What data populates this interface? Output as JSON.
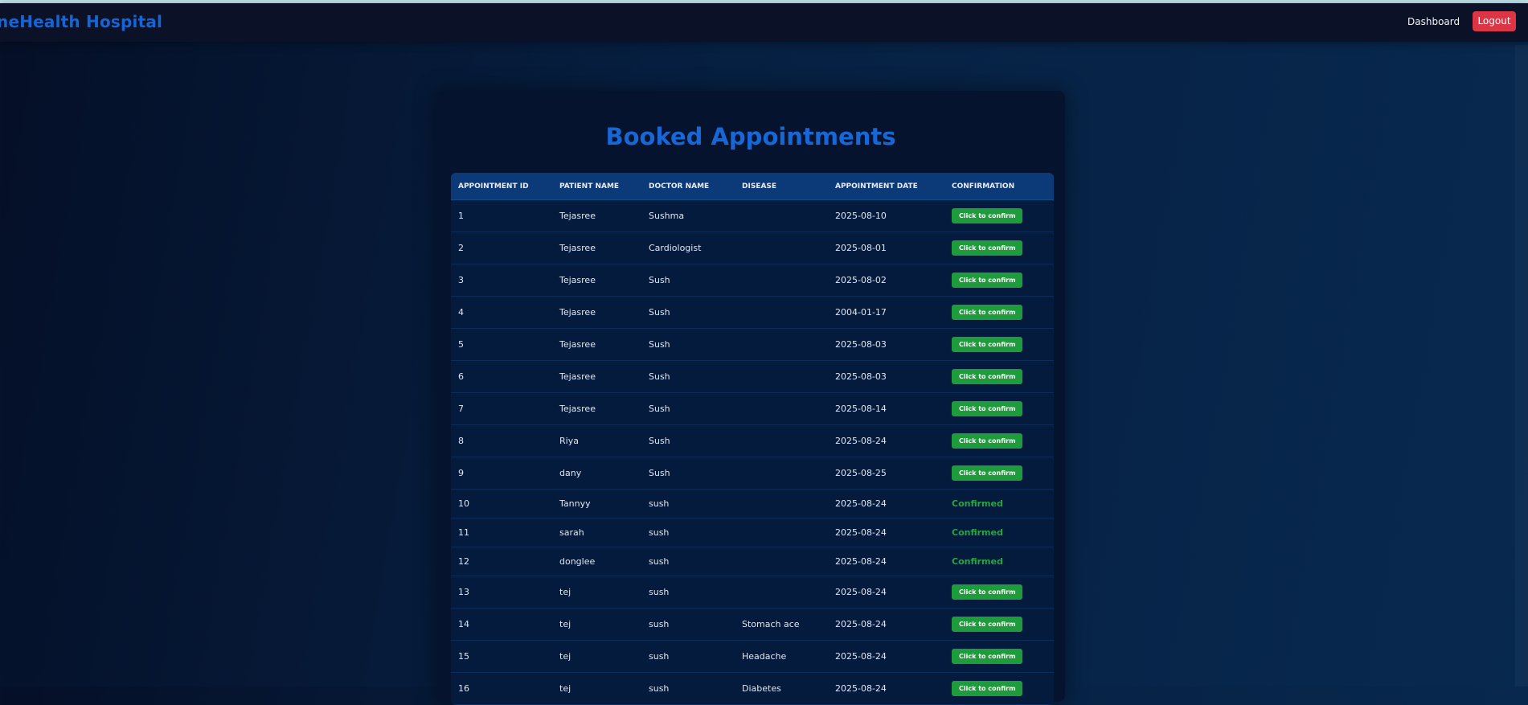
{
  "navbar": {
    "brand": "neHealth Hospital",
    "dashboard_label": "Dashboard",
    "logout_label": "Logout"
  },
  "page": {
    "title": "Booked Appointments"
  },
  "table": {
    "headers": [
      "APPOINTMENT ID",
      "PATIENT NAME",
      "DOCTOR NAME",
      "DISEASE",
      "APPOINTMENT DATE",
      "CONFIRMATION"
    ],
    "rows": [
      {
        "id": "1",
        "patient": "Tejasree",
        "doctor": "Sushma",
        "disease": "",
        "date": "2025-08-10",
        "status": "Click to confirm"
      },
      {
        "id": "2",
        "patient": "Tejasree",
        "doctor": "Cardiologist",
        "disease": "",
        "date": "2025-08-01",
        "status": "Click to confirm"
      },
      {
        "id": "3",
        "patient": "Tejasree",
        "doctor": "Sush",
        "disease": "",
        "date": "2025-08-02",
        "status": "Click to confirm"
      },
      {
        "id": "4",
        "patient": "Tejasree",
        "doctor": "Sush",
        "disease": "",
        "date": "2004-01-17",
        "status": "Click to confirm"
      },
      {
        "id": "5",
        "patient": "Tejasree",
        "doctor": "Sush",
        "disease": "",
        "date": "2025-08-03",
        "status": "Click to confirm"
      },
      {
        "id": "6",
        "patient": "Tejasree",
        "doctor": "Sush",
        "disease": "",
        "date": "2025-08-03",
        "status": "Click to confirm"
      },
      {
        "id": "7",
        "patient": "Tejasree",
        "doctor": "Sush",
        "disease": "",
        "date": "2025-08-14",
        "status": "Click to confirm"
      },
      {
        "id": "8",
        "patient": "Riya",
        "doctor": "Sush",
        "disease": "",
        "date": "2025-08-24",
        "status": "Click to confirm"
      },
      {
        "id": "9",
        "patient": "dany",
        "doctor": "Sush",
        "disease": "",
        "date": "2025-08-25",
        "status": "Click to confirm"
      },
      {
        "id": "10",
        "patient": "Tannyy",
        "doctor": "sush",
        "disease": "",
        "date": "2025-08-24",
        "status": "Confirmed"
      },
      {
        "id": "11",
        "patient": "sarah",
        "doctor": "sush",
        "disease": "",
        "date": "2025-08-24",
        "status": "Confirmed"
      },
      {
        "id": "12",
        "patient": "donglee",
        "doctor": "sush",
        "disease": "",
        "date": "2025-08-24",
        "status": "Confirmed"
      },
      {
        "id": "13",
        "patient": "tej",
        "doctor": "sush",
        "disease": "",
        "date": "2025-08-24",
        "status": "Click to confirm"
      },
      {
        "id": "14",
        "patient": "tej",
        "doctor": "sush",
        "disease": "Stomach ace",
        "date": "2025-08-24",
        "status": "Click to confirm"
      },
      {
        "id": "15",
        "patient": "tej",
        "doctor": "sush",
        "disease": "Headache",
        "date": "2025-08-24",
        "status": "Click to confirm"
      },
      {
        "id": "16",
        "patient": "tej",
        "doctor": "sush",
        "disease": "Diabetes",
        "date": "2025-08-24",
        "status": "Click to confirm"
      }
    ]
  },
  "colors": {
    "brand": "#1565d8",
    "confirm_button": "#1e9b3a",
    "confirmed_text": "#26a541",
    "logout": "#dc3545",
    "table_header": "#0c3a78"
  }
}
